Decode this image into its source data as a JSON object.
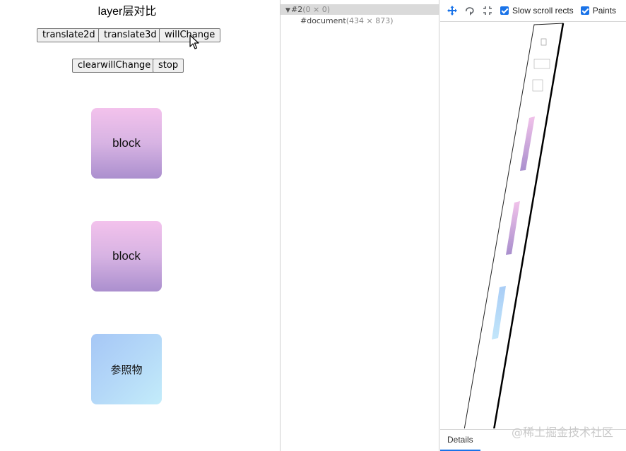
{
  "demo": {
    "title": "layer层对比",
    "buttons": {
      "translate2d": "translate2d",
      "translate3d": "translate3d",
      "willchange": "willChange",
      "clearwillchange": "clearwillChange",
      "stop": "stop"
    },
    "blocks": [
      "block",
      "block",
      "参照物"
    ]
  },
  "layer_tree": {
    "rows": [
      {
        "name": "#2",
        "dims": "(0 × 0)",
        "selected": true
      },
      {
        "name": "#document",
        "dims": "(434 × 873)"
      }
    ]
  },
  "toolbar": {
    "icons": [
      "pan-mode-icon",
      "rotate-mode-icon",
      "reset-transform-icon"
    ],
    "slow_scroll_rects": "Slow scroll rects",
    "paints": "Paints"
  },
  "details_tab": "Details",
  "watermark": "@稀土掘金技术社区",
  "colors": {
    "block_purple_top": "#f3c2ec",
    "block_purple_bottom": "#ab8fce",
    "block_blue": "#b4d8f8",
    "accent": "#1a73e8"
  }
}
